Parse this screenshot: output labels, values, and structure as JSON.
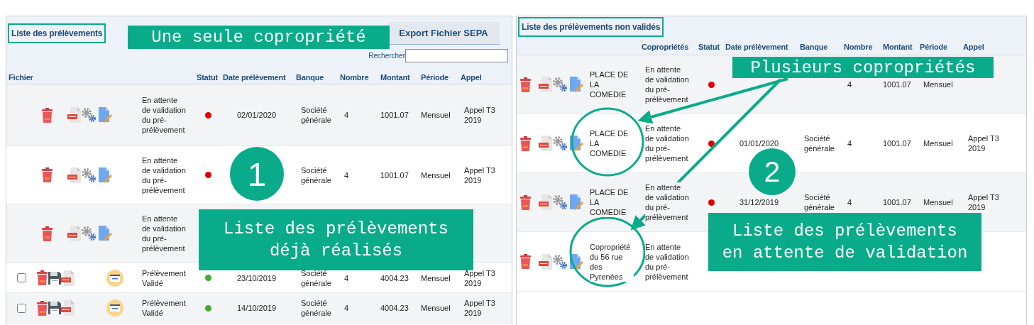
{
  "panels": [
    {
      "kind": "single",
      "title": "Liste des prélèvements",
      "highlighted": true,
      "export_button": "Export Fichier SEPA",
      "search": {
        "label": "Rechercher"
      },
      "columns": [
        "Fichier",
        "Statut",
        "Date prélèvement",
        "Banque",
        "Nombre",
        "Montant",
        "Période",
        "Appel"
      ],
      "rows": [
        {
          "kind": "pending",
          "status": "En attente de validation du pré-prélèvement",
          "color": "#e00000",
          "date": "02/01/2020",
          "bank": "Société générale",
          "count": "4",
          "amount": "1001.07",
          "period": "Mensuel",
          "call": "Appel T3 2019"
        },
        {
          "kind": "pending",
          "status": "En attente de validation du pré-prélèvement",
          "color": "#e00000",
          "bank": "Société générale",
          "count": "4",
          "amount": "1001.07",
          "period": "Mensuel",
          "call": "Appel T3 2019"
        },
        {
          "kind": "pending",
          "status": "En attente de validation du pré-prélèvement"
        },
        {
          "kind": "validated",
          "checked": false,
          "status": "Prélèvement Validé",
          "color": "#3fae2a",
          "date": "23/10/2019",
          "bank": "Société générale",
          "count": "4",
          "amount": "4004.23",
          "period": "Mensuel",
          "call": "Appel T3 2019"
        },
        {
          "kind": "validated",
          "checked": false,
          "status": "Prélèvement Validé",
          "color": "#3fae2a",
          "date": "14/10/2019",
          "bank": "Société générale",
          "count": "4",
          "amount": "4004.23",
          "period": "Mensuel",
          "call": "Appel T3 2019"
        }
      ]
    },
    {
      "kind": "multi",
      "title": "Liste des prélèvements non validés",
      "highlighted": true,
      "columns": [
        "Copropriétés",
        "Statut",
        "Date prélèvement",
        "Banque",
        "Nombre",
        "Montant",
        "Période",
        "Appel"
      ],
      "rows": [
        {
          "kind": "pending",
          "copro": "PLACE DE LA COMEDIE",
          "status": "En attente de validation du pré-prélèvement",
          "color": "#e00000",
          "count": "4",
          "amount": "1001.07",
          "period": "Mensuel"
        },
        {
          "kind": "pending",
          "copro": "PLACE DE LA COMEDIE",
          "status": "En attente de validation du pré-prélèvement",
          "color": "#e00000",
          "date": "01/01/2020",
          "bank": "Société générale",
          "count": "4",
          "amount": "1001.07",
          "period": "Mensuel",
          "call": "Appel T3 2019"
        },
        {
          "kind": "pending",
          "copro": "PLACE DE LA COMEDIE",
          "status": "En attente de validation du pré-prélèvement",
          "color": "#e00000",
          "date": "31/12/2019",
          "bank": "Société générale",
          "count": "4",
          "amount": "1001.07",
          "period": "Mensuel",
          "call": "Appel T3 2019"
        },
        {
          "kind": "pending",
          "copro": "Copropriété du 56 rue des Pyrenées",
          "status": "En attente de validation du pré-prélèvement"
        }
      ]
    }
  ],
  "annotations": [
    {
      "kind": "label",
      "lines": [
        "Une seule copropriété"
      ]
    },
    {
      "kind": "number",
      "text": "1"
    },
    {
      "kind": "label",
      "lines": [
        "Liste des prélèvements",
        "déjà réalisés"
      ]
    },
    {
      "kind": "label",
      "lines": [
        "Plusieurs copropriétés"
      ]
    },
    {
      "kind": "number",
      "text": "2"
    },
    {
      "kind": "label",
      "lines": [
        "Liste des prélèvements",
        "en attente de validation"
      ]
    }
  ]
}
